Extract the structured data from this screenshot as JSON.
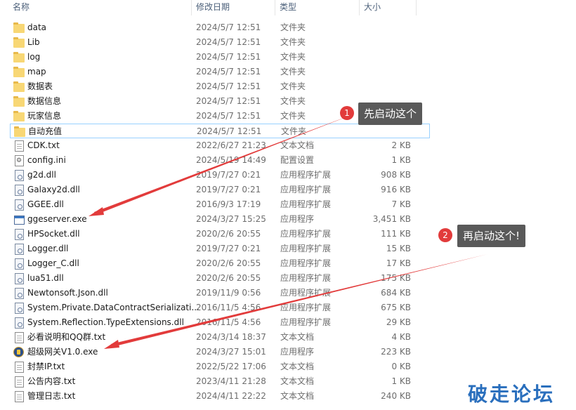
{
  "columns": {
    "name": "名称",
    "date": "修改日期",
    "type": "类型",
    "size": "大小"
  },
  "files": [
    {
      "name": "data",
      "date": "2024/5/7 12:51",
      "type": "文件夹",
      "size": "",
      "icon": "folder-icon"
    },
    {
      "name": "Lib",
      "date": "2024/5/7 12:51",
      "type": "文件夹",
      "size": "",
      "icon": "folder-icon"
    },
    {
      "name": "log",
      "date": "2024/5/7 12:51",
      "type": "文件夹",
      "size": "",
      "icon": "folder-icon"
    },
    {
      "name": "map",
      "date": "2024/5/7 12:51",
      "type": "文件夹",
      "size": "",
      "icon": "folder-icon"
    },
    {
      "name": "数据表",
      "date": "2024/5/7 12:51",
      "type": "文件夹",
      "size": "",
      "icon": "folder-icon"
    },
    {
      "name": "数据信息",
      "date": "2024/5/7 12:51",
      "type": "文件夹",
      "size": "",
      "icon": "folder-icon"
    },
    {
      "name": "玩家信息",
      "date": "2024/5/7 12:51",
      "type": "文件夹",
      "size": "",
      "icon": "folder-icon"
    },
    {
      "name": "自动充值",
      "date": "2024/5/7 12:51",
      "type": "文件夹",
      "size": "",
      "icon": "folder-icon"
    },
    {
      "name": "CDK.txt",
      "date": "2022/6/27 21:23",
      "type": "文本文档",
      "size": "2 KB",
      "icon": "text-file-icon"
    },
    {
      "name": "config.ini",
      "date": "2024/5/19 14:49",
      "type": "配置设置",
      "size": "1 KB",
      "icon": "settings-file-icon"
    },
    {
      "name": "g2d.dll",
      "date": "2019/7/27 0:21",
      "type": "应用程序扩展",
      "size": "908 KB",
      "icon": "dll-file-icon"
    },
    {
      "name": "Galaxy2d.dll",
      "date": "2019/7/27 0:21",
      "type": "应用程序扩展",
      "size": "916 KB",
      "icon": "dll-file-icon"
    },
    {
      "name": "GGEE.dll",
      "date": "2016/9/3 17:19",
      "type": "应用程序扩展",
      "size": "7 KB",
      "icon": "dll-file-icon"
    },
    {
      "name": "ggeserver.exe",
      "date": "2024/3/27 15:25",
      "type": "应用程序",
      "size": "3,451 KB",
      "icon": "exe-file-icon"
    },
    {
      "name": "HPSocket.dll",
      "date": "2020/2/6 20:55",
      "type": "应用程序扩展",
      "size": "111 KB",
      "icon": "dll-file-icon"
    },
    {
      "name": "Logger.dll",
      "date": "2019/7/27 0:21",
      "type": "应用程序扩展",
      "size": "15 KB",
      "icon": "dll-file-icon"
    },
    {
      "name": "Logger_C.dll",
      "date": "2020/2/6 20:55",
      "type": "应用程序扩展",
      "size": "17 KB",
      "icon": "dll-file-icon"
    },
    {
      "name": "lua51.dll",
      "date": "2020/2/6 20:55",
      "type": "应用程序扩展",
      "size": "175 KB",
      "icon": "dll-file-icon"
    },
    {
      "name": "Newtonsoft.Json.dll",
      "date": "2019/11/9 0:56",
      "type": "应用程序扩展",
      "size": "684 KB",
      "icon": "dll-file-icon"
    },
    {
      "name": "System.Private.DataContractSerializati...",
      "date": "2016/11/5 4:56",
      "type": "应用程序扩展",
      "size": "675 KB",
      "icon": "dll-file-icon"
    },
    {
      "name": "System.Reflection.TypeExtensions.dll",
      "date": "2016/11/5 4:56",
      "type": "应用程序扩展",
      "size": "29 KB",
      "icon": "dll-file-icon"
    },
    {
      "name": "必看说明和QQ群.txt",
      "date": "2024/3/14 18:37",
      "type": "文本文档",
      "size": "4 KB",
      "icon": "text-file-icon"
    },
    {
      "name": "超级网关V1.0.exe",
      "date": "2024/3/27 15:01",
      "type": "应用程序",
      "size": "223 KB",
      "icon": "app-logo-icon"
    },
    {
      "name": "封禁IP.txt",
      "date": "2022/5/22 17:06",
      "type": "文本文档",
      "size": "0 KB",
      "icon": "text-file-icon"
    },
    {
      "name": "公告内容.txt",
      "date": "2023/4/11 21:28",
      "type": "文本文档",
      "size": "1 KB",
      "icon": "text-file-icon"
    },
    {
      "name": "管理日志.txt",
      "date": "2024/4/11 22:22",
      "type": "文本文档",
      "size": "240 KB",
      "icon": "text-file-icon"
    }
  ],
  "selected_index": 7,
  "annotations": [
    {
      "number": "1",
      "text": "先启动这个"
    },
    {
      "number": "2",
      "text": "再启动这个!"
    }
  ],
  "watermark": "破走论坛",
  "colors": {
    "arrow": "#e23b3b",
    "callout_bg": "#595959",
    "folder": "#f8d775",
    "selection_border": "#99d1ff"
  }
}
